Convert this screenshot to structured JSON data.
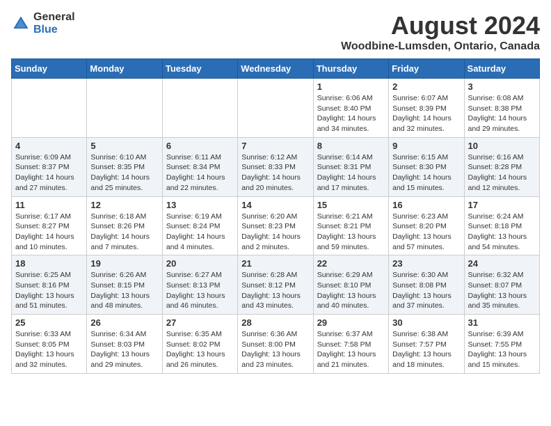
{
  "header": {
    "logo_general": "General",
    "logo_blue": "Blue",
    "month_title": "August 2024",
    "location": "Woodbine-Lumsden, Ontario, Canada"
  },
  "days_of_week": [
    "Sunday",
    "Monday",
    "Tuesday",
    "Wednesday",
    "Thursday",
    "Friday",
    "Saturday"
  ],
  "weeks": [
    [
      {
        "day": "",
        "content": ""
      },
      {
        "day": "",
        "content": ""
      },
      {
        "day": "",
        "content": ""
      },
      {
        "day": "",
        "content": ""
      },
      {
        "day": "1",
        "content": "Sunrise: 6:06 AM\nSunset: 8:40 PM\nDaylight: 14 hours\nand 34 minutes."
      },
      {
        "day": "2",
        "content": "Sunrise: 6:07 AM\nSunset: 8:39 PM\nDaylight: 14 hours\nand 32 minutes."
      },
      {
        "day": "3",
        "content": "Sunrise: 6:08 AM\nSunset: 8:38 PM\nDaylight: 14 hours\nand 29 minutes."
      }
    ],
    [
      {
        "day": "4",
        "content": "Sunrise: 6:09 AM\nSunset: 8:37 PM\nDaylight: 14 hours\nand 27 minutes."
      },
      {
        "day": "5",
        "content": "Sunrise: 6:10 AM\nSunset: 8:35 PM\nDaylight: 14 hours\nand 25 minutes."
      },
      {
        "day": "6",
        "content": "Sunrise: 6:11 AM\nSunset: 8:34 PM\nDaylight: 14 hours\nand 22 minutes."
      },
      {
        "day": "7",
        "content": "Sunrise: 6:12 AM\nSunset: 8:33 PM\nDaylight: 14 hours\nand 20 minutes."
      },
      {
        "day": "8",
        "content": "Sunrise: 6:14 AM\nSunset: 8:31 PM\nDaylight: 14 hours\nand 17 minutes."
      },
      {
        "day": "9",
        "content": "Sunrise: 6:15 AM\nSunset: 8:30 PM\nDaylight: 14 hours\nand 15 minutes."
      },
      {
        "day": "10",
        "content": "Sunrise: 6:16 AM\nSunset: 8:28 PM\nDaylight: 14 hours\nand 12 minutes."
      }
    ],
    [
      {
        "day": "11",
        "content": "Sunrise: 6:17 AM\nSunset: 8:27 PM\nDaylight: 14 hours\nand 10 minutes."
      },
      {
        "day": "12",
        "content": "Sunrise: 6:18 AM\nSunset: 8:26 PM\nDaylight: 14 hours\nand 7 minutes."
      },
      {
        "day": "13",
        "content": "Sunrise: 6:19 AM\nSunset: 8:24 PM\nDaylight: 14 hours\nand 4 minutes."
      },
      {
        "day": "14",
        "content": "Sunrise: 6:20 AM\nSunset: 8:23 PM\nDaylight: 14 hours\nand 2 minutes."
      },
      {
        "day": "15",
        "content": "Sunrise: 6:21 AM\nSunset: 8:21 PM\nDaylight: 13 hours\nand 59 minutes."
      },
      {
        "day": "16",
        "content": "Sunrise: 6:23 AM\nSunset: 8:20 PM\nDaylight: 13 hours\nand 57 minutes."
      },
      {
        "day": "17",
        "content": "Sunrise: 6:24 AM\nSunset: 8:18 PM\nDaylight: 13 hours\nand 54 minutes."
      }
    ],
    [
      {
        "day": "18",
        "content": "Sunrise: 6:25 AM\nSunset: 8:16 PM\nDaylight: 13 hours\nand 51 minutes."
      },
      {
        "day": "19",
        "content": "Sunrise: 6:26 AM\nSunset: 8:15 PM\nDaylight: 13 hours\nand 48 minutes."
      },
      {
        "day": "20",
        "content": "Sunrise: 6:27 AM\nSunset: 8:13 PM\nDaylight: 13 hours\nand 46 minutes."
      },
      {
        "day": "21",
        "content": "Sunrise: 6:28 AM\nSunset: 8:12 PM\nDaylight: 13 hours\nand 43 minutes."
      },
      {
        "day": "22",
        "content": "Sunrise: 6:29 AM\nSunset: 8:10 PM\nDaylight: 13 hours\nand 40 minutes."
      },
      {
        "day": "23",
        "content": "Sunrise: 6:30 AM\nSunset: 8:08 PM\nDaylight: 13 hours\nand 37 minutes."
      },
      {
        "day": "24",
        "content": "Sunrise: 6:32 AM\nSunset: 8:07 PM\nDaylight: 13 hours\nand 35 minutes."
      }
    ],
    [
      {
        "day": "25",
        "content": "Sunrise: 6:33 AM\nSunset: 8:05 PM\nDaylight: 13 hours\nand 32 minutes."
      },
      {
        "day": "26",
        "content": "Sunrise: 6:34 AM\nSunset: 8:03 PM\nDaylight: 13 hours\nand 29 minutes."
      },
      {
        "day": "27",
        "content": "Sunrise: 6:35 AM\nSunset: 8:02 PM\nDaylight: 13 hours\nand 26 minutes."
      },
      {
        "day": "28",
        "content": "Sunrise: 6:36 AM\nSunset: 8:00 PM\nDaylight: 13 hours\nand 23 minutes."
      },
      {
        "day": "29",
        "content": "Sunrise: 6:37 AM\nSunset: 7:58 PM\nDaylight: 13 hours\nand 21 minutes."
      },
      {
        "day": "30",
        "content": "Sunrise: 6:38 AM\nSunset: 7:57 PM\nDaylight: 13 hours\nand 18 minutes."
      },
      {
        "day": "31",
        "content": "Sunrise: 6:39 AM\nSunset: 7:55 PM\nDaylight: 13 hours\nand 15 minutes."
      }
    ]
  ]
}
